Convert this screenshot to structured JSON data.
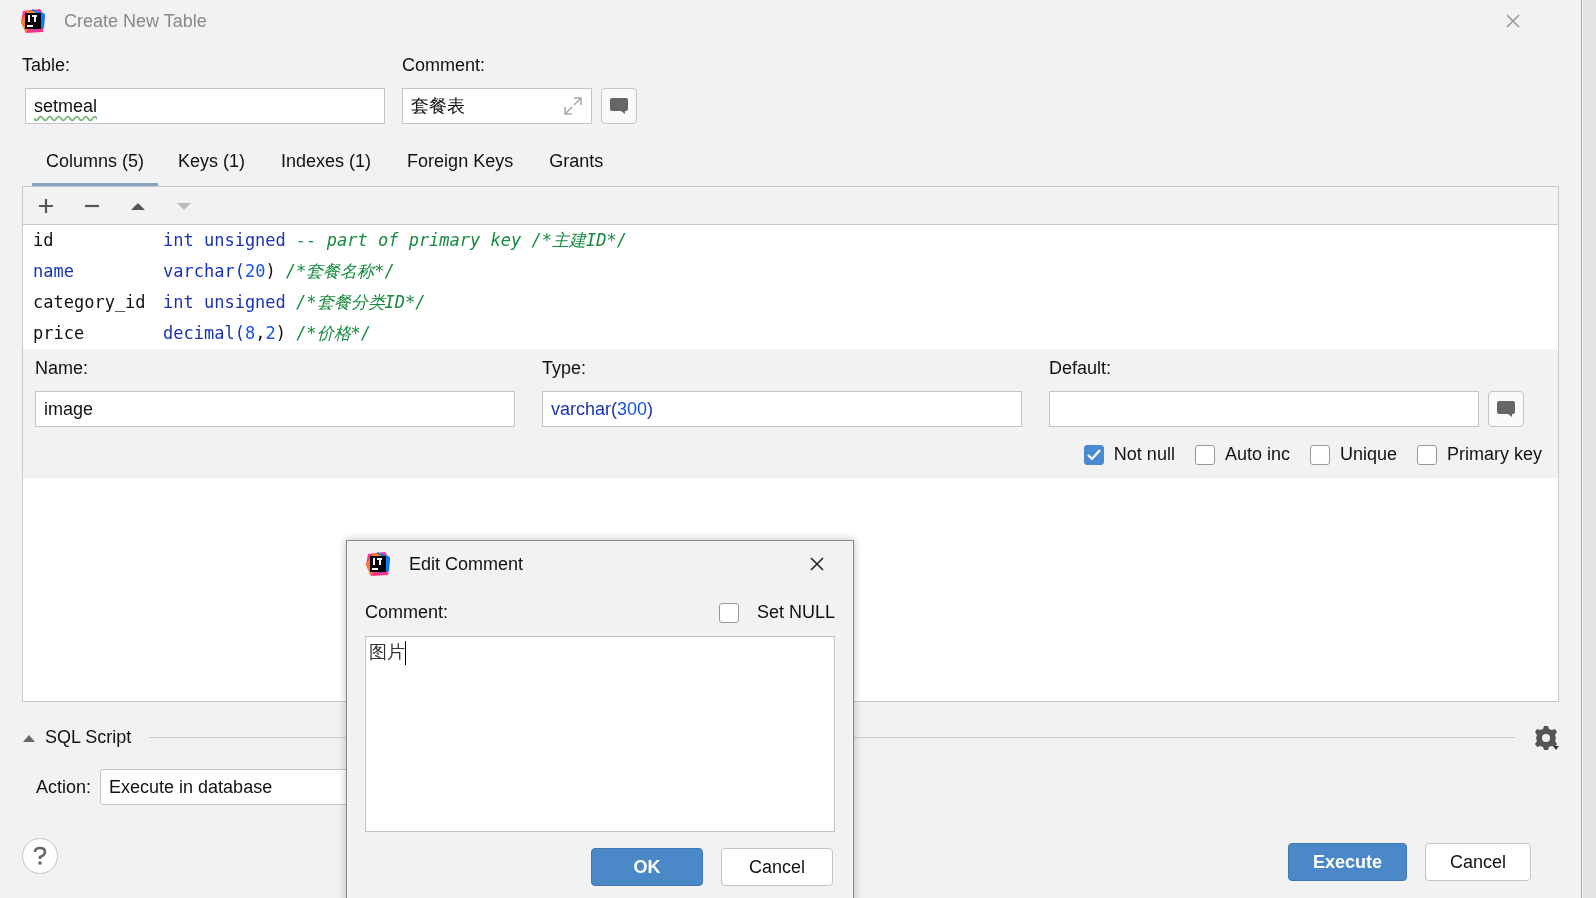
{
  "window": {
    "title": "Create New Table"
  },
  "table_field": {
    "label": "Table:",
    "value": "setmeal"
  },
  "comment_field": {
    "label": "Comment:",
    "value": "套餐表"
  },
  "tabs": [
    {
      "label": "Columns (5)",
      "selected": true
    },
    {
      "label": "Keys (1)",
      "selected": false
    },
    {
      "label": "Indexes (1)",
      "selected": false
    },
    {
      "label": "Foreign Keys",
      "selected": false
    },
    {
      "label": "Grants",
      "selected": false
    }
  ],
  "toolbar": [
    {
      "kind": "add",
      "disabled": false
    },
    {
      "kind": "remove",
      "disabled": false
    },
    {
      "kind": "up",
      "disabled": false
    },
    {
      "kind": "down",
      "disabled": true
    }
  ],
  "columns": [
    {
      "name": {
        "kind": "plain",
        "text": "id"
      },
      "definition": [
        {
          "kind": "keyword",
          "text": "int unsigned"
        },
        {
          "kind": "comment",
          "text": "-- part of primary key /*主建ID*/"
        }
      ]
    },
    {
      "name": {
        "kind": "keyword",
        "text": "name"
      },
      "definition": [
        {
          "kind": "keyword",
          "text": "varchar("
        },
        {
          "kind": "number",
          "text": "20"
        },
        {
          "kind": "plain",
          "text": ")"
        },
        {
          "kind": "comment",
          "text": "/*套餐名称*/"
        }
      ]
    },
    {
      "name": {
        "kind": "plain",
        "text": "category_id"
      },
      "definition": [
        {
          "kind": "keyword",
          "text": "int unsigned"
        },
        {
          "kind": "comment",
          "text": "/*套餐分类ID*/"
        }
      ]
    },
    {
      "name": {
        "kind": "plain",
        "text": "price"
      },
      "definition": [
        {
          "kind": "keyword",
          "text": "decimal("
        },
        {
          "kind": "number",
          "text": "8"
        },
        {
          "kind": "plain",
          "text": ","
        },
        {
          "kind": "number",
          "text": "2"
        },
        {
          "kind": "plain",
          "text": ")"
        },
        {
          "kind": "comment",
          "text": "/*价格*/"
        }
      ]
    }
  ],
  "column_details": {
    "name_label": "Name:",
    "name_value": "image",
    "type_label": "Type:",
    "type_value": [
      {
        "kind": "keyword",
        "text": "varchar("
      },
      {
        "kind": "number",
        "text": "300"
      },
      {
        "kind": "keyword",
        "text": ")"
      }
    ],
    "default_label": "Default:",
    "options": [
      {
        "label": "Not null",
        "checked": true
      },
      {
        "label": "Auto inc",
        "checked": false
      },
      {
        "label": "Unique",
        "checked": false
      },
      {
        "label": "Primary key",
        "checked": false
      }
    ]
  },
  "sql_script": {
    "label": "SQL Script",
    "expanded": true,
    "action_label": "Action:",
    "action_value": "Execute in database"
  },
  "buttons": [
    {
      "label": "Execute",
      "kind": "primary"
    },
    {
      "label": "Cancel",
      "kind": "secondary"
    }
  ],
  "edit_comment_dialog": {
    "title": "Edit Comment",
    "label": "Comment:",
    "set_null": {
      "label": "Set NULL",
      "checked": false
    },
    "value": "图片",
    "buttons": [
      {
        "label": "OK",
        "kind": "primary"
      },
      {
        "label": "Cancel",
        "kind": "secondary"
      }
    ]
  }
}
